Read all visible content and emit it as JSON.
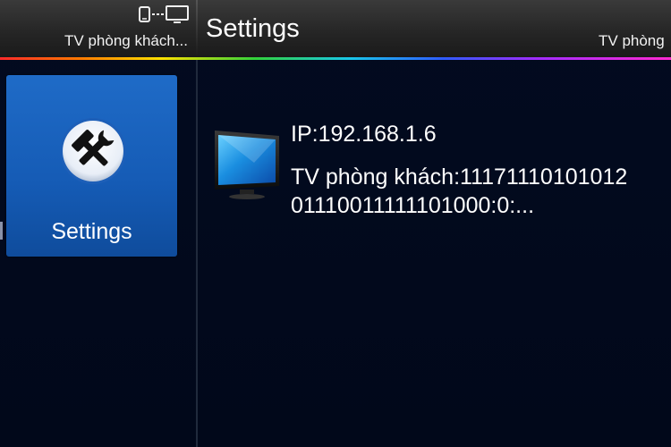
{
  "header": {
    "device_name": "TV phòng khách...",
    "title": "Settings",
    "right_device_name": "TV phòng"
  },
  "sidebar": {
    "tile": {
      "label": "Settings",
      "icon": "tools-icon"
    }
  },
  "main": {
    "device": {
      "icon": "tv-icon",
      "ip": "IP:192.168.1.6",
      "name_line1": "TV phòng khách:11171110101012",
      "name_line2": "01110011111101000:0:..."
    }
  },
  "colors": {
    "background": "#020a1e",
    "tile": "#1a63c0",
    "topbar": "#2a2a2a"
  }
}
